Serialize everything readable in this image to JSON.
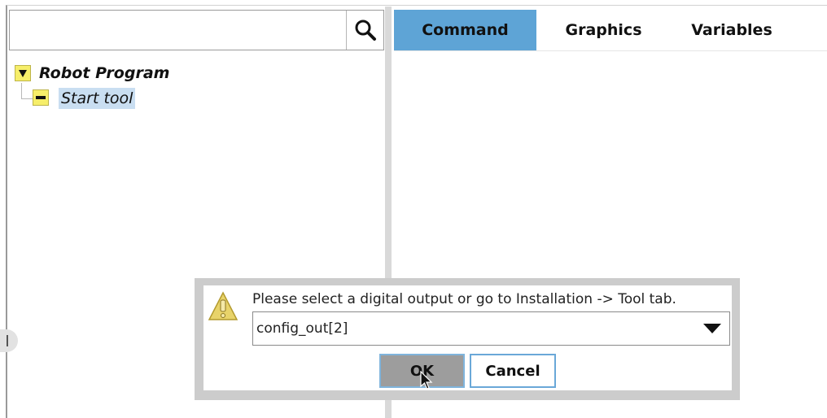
{
  "search": {
    "value": "",
    "placeholder": ""
  },
  "icons": {
    "search": "magnifier-icon",
    "expand": "triangle-down-icon",
    "node": "minus-node-icon",
    "warning": "warning-triangle-icon",
    "dropdown": "caret-down-icon",
    "cursor": "mouse-pointer-icon"
  },
  "tree": {
    "root_label": "Robot Program",
    "children": [
      {
        "label": "Start tool",
        "selected": true
      }
    ]
  },
  "tabs": [
    {
      "label": "Command",
      "active": true
    },
    {
      "label": "Graphics",
      "active": false
    },
    {
      "label": "Variables",
      "active": false
    }
  ],
  "dialog": {
    "message": "Please select a digital output or go to Installation -> Tool tab.",
    "select_value": "config_out[2]",
    "ok_label": "OK",
    "cancel_label": "Cancel"
  },
  "colors": {
    "active_tab": "#5ea4d6",
    "tree_node_bg": "#f6ee6a",
    "selected_node_bg": "#c9def1",
    "dialog_frame": "#cccccc",
    "ok_button_bg": "#9d9d9d",
    "button_border": "#6aa8d8"
  }
}
